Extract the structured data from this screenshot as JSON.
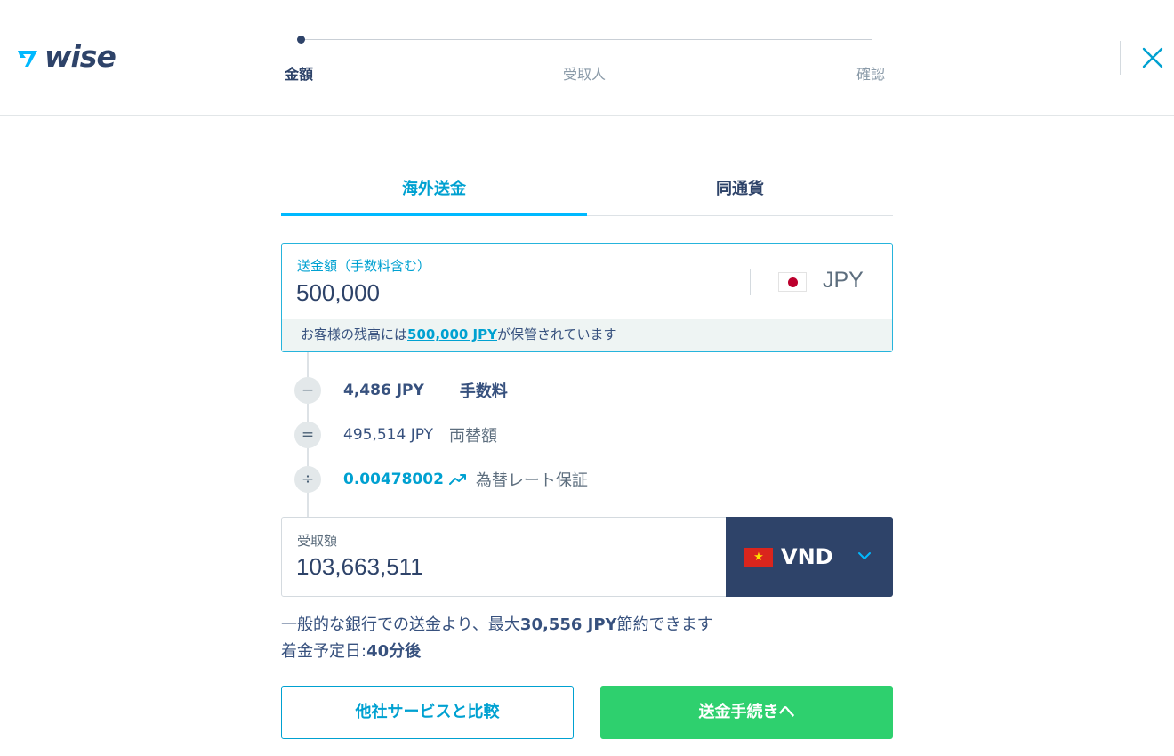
{
  "header": {
    "logo_text": "wise",
    "steps": [
      {
        "label": "金額",
        "active": true
      },
      {
        "label": "受取人",
        "active": false
      },
      {
        "label": "確認",
        "active": false
      }
    ],
    "close_icon": "close-icon"
  },
  "tabs": [
    {
      "label": "海外送金",
      "active": true
    },
    {
      "label": "同通貨",
      "active": false
    }
  ],
  "send": {
    "label": "送金額（手数料含む）",
    "value": "500,000",
    "currency": "JPY",
    "balance_prefix": "お客様の残高には",
    "balance_link": "500,000 JPY",
    "balance_suffix": "が保管されています"
  },
  "breakdown": {
    "fee": {
      "operator": "−",
      "amount": "4,486 JPY",
      "label": "手数料"
    },
    "converted": {
      "operator": "=",
      "amount": "495,514 JPY",
      "label": "両替額"
    },
    "rate": {
      "operator": "÷",
      "amount": "0.00478002",
      "label": "為替レート保証",
      "icon": "trend-up-icon"
    }
  },
  "receive": {
    "label": "受取額",
    "value": "103,663,511",
    "currency": "VND"
  },
  "info": {
    "savings_prefix": "一般的な銀行での送金より、最大",
    "savings_amount": "30,556 JPY",
    "savings_suffix": "節約できます",
    "eta_prefix": "着金予定日:",
    "eta_value": "40分後"
  },
  "buttons": {
    "compare": "他社サービスと比較",
    "continue": "送金手続きへ"
  },
  "colors": {
    "brand_navy": "#2e4369",
    "accent_blue": "#00a1d1",
    "cta_green": "#2ed06e"
  }
}
